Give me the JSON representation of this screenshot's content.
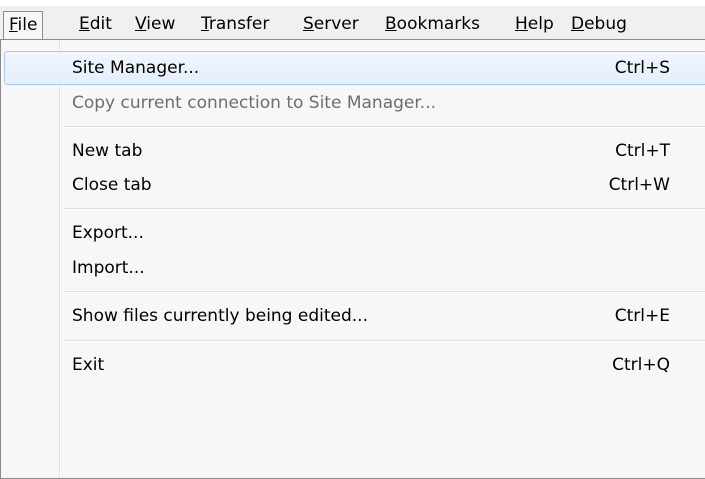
{
  "menubar": {
    "items": [
      {
        "mnemonic": "F",
        "rest": "ile"
      },
      {
        "mnemonic": "E",
        "rest": "dit"
      },
      {
        "mnemonic": "V",
        "rest": "iew"
      },
      {
        "mnemonic": "T",
        "rest": "ransfer"
      },
      {
        "mnemonic": "S",
        "rest": "erver"
      },
      {
        "mnemonic": "B",
        "rest": "ookmarks"
      },
      {
        "mnemonic": "H",
        "rest": "elp"
      },
      {
        "mnemonic": "D",
        "rest": "ebug"
      }
    ]
  },
  "file_menu": {
    "site_manager": {
      "label": "Site Manager...",
      "shortcut": "Ctrl+S"
    },
    "copy_connection": {
      "label": "Copy current connection to Site Manager..."
    },
    "new_tab": {
      "label": "New tab",
      "shortcut": "Ctrl+T"
    },
    "close_tab": {
      "label": "Close tab",
      "shortcut": "Ctrl+W"
    },
    "export": {
      "label": "Export..."
    },
    "import": {
      "label": "Import..."
    },
    "show_edited": {
      "label": "Show files currently being edited...",
      "shortcut": "Ctrl+E"
    },
    "exit": {
      "label": "Exit",
      "shortcut": "Ctrl+Q"
    }
  },
  "colors": {
    "hover_border": "#a8c8ec",
    "disabled_text": "#6d6d6d",
    "menu_background": "#f7f7f7",
    "menubar_background": "#f0f0f0"
  }
}
